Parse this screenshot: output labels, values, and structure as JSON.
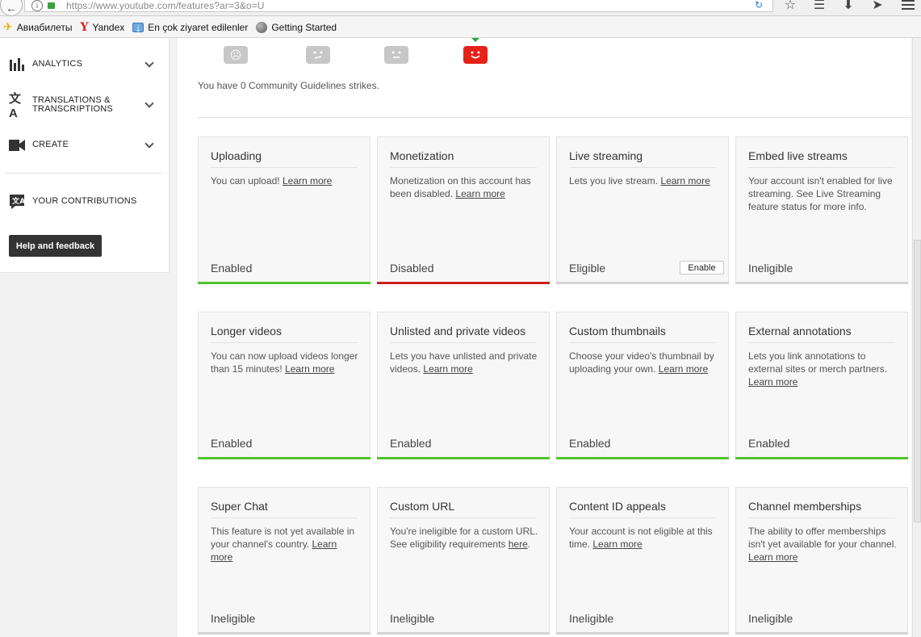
{
  "browser": {
    "url": "https://www.youtube.com/features?ar=3&o=U",
    "bookmarks": [
      {
        "label": "Авиабилеты",
        "icon": "airplane-icon"
      },
      {
        "label": "Yandex",
        "icon": "yandex-icon"
      },
      {
        "label": "En çok ziyaret edilenler",
        "icon": "folder-icon"
      },
      {
        "label": "Getting Started",
        "icon": "globe-icon"
      }
    ]
  },
  "sidebar": {
    "items": [
      {
        "label": "ANALYTICS",
        "icon": "analytics-icon"
      },
      {
        "label": "TRANSLATIONS & TRANSCRIPTIONS",
        "label_line1": "TRANSLATIONS &",
        "label_line2": "TRANSCRIPTIONS",
        "icon": "translate-icon"
      },
      {
        "label": "CREATE",
        "icon": "video-camera-icon"
      },
      {
        "label": "YOUR CONTRIBUTIONS",
        "icon": "contributions-icon"
      }
    ],
    "help_button": "Help and feedback"
  },
  "strikes": {
    "text": "You have 0 Community Guidelines strikes.",
    "icons": [
      {
        "name": "sad-face-icon",
        "glyph": "☹"
      },
      {
        "name": "meh-face-icon",
        "glyph": "•"
      },
      {
        "name": "neutral-face-icon",
        "glyph": "•"
      },
      {
        "name": "happy-face-icon",
        "glyph": "☺"
      }
    ],
    "active_color": "#e62117"
  },
  "features": [
    {
      "title": "Uploading",
      "desc": "You can upload!",
      "link": "Learn more",
      "status": "Enabled",
      "status_color": "green"
    },
    {
      "title": "Monetization",
      "desc": "Monetization on this account has been disabled.",
      "link": "Learn more",
      "status": "Disabled",
      "status_color": "red"
    },
    {
      "title": "Live streaming",
      "desc": "Lets you live stream.",
      "link": "Learn more",
      "status": "Eligible",
      "status_color": "gray",
      "button": "Enable"
    },
    {
      "title": "Embed live streams",
      "desc": "Your account isn't enabled for live streaming. See Live Streaming feature status for more info.",
      "link": "",
      "status": "Ineligible",
      "status_color": "gray"
    },
    {
      "title": "Longer videos",
      "desc": "You can now upload videos longer than 15 minutes!",
      "link": "Learn more",
      "status": "Enabled",
      "status_color": "green"
    },
    {
      "title": "Unlisted and private videos",
      "desc": "Lets you have unlisted and private videos.",
      "link": "Learn more",
      "status": "Enabled",
      "status_color": "green"
    },
    {
      "title": "Custom thumbnails",
      "desc": "Choose your video's thumbnail by uploading your own.",
      "link": "Learn more",
      "status": "Enabled",
      "status_color": "green"
    },
    {
      "title": "External annotations",
      "desc": "Lets you link annotations to external sites or merch partners.",
      "link": "Learn more",
      "status": "Enabled",
      "status_color": "green"
    },
    {
      "title": "Super Chat",
      "desc": "This feature is not yet available in your channel's country.",
      "link": "Learn more",
      "status": "Ineligible",
      "status_color": "gray"
    },
    {
      "title": "Custom URL",
      "desc": "You're ineligible for a custom URL. See eligibility requirements",
      "link": "here",
      "link_suffix": ".",
      "status": "Ineligible",
      "status_color": "gray"
    },
    {
      "title": "Content ID appeals",
      "desc": "Your account is not eligible at this time.",
      "link": "Learn more",
      "status": "Ineligible",
      "status_color": "gray"
    },
    {
      "title": "Channel memberships",
      "desc": "The ability to offer memberships isn't yet available for your channel.",
      "link": "Learn more",
      "status": "Ineligible",
      "status_color": "gray"
    }
  ]
}
